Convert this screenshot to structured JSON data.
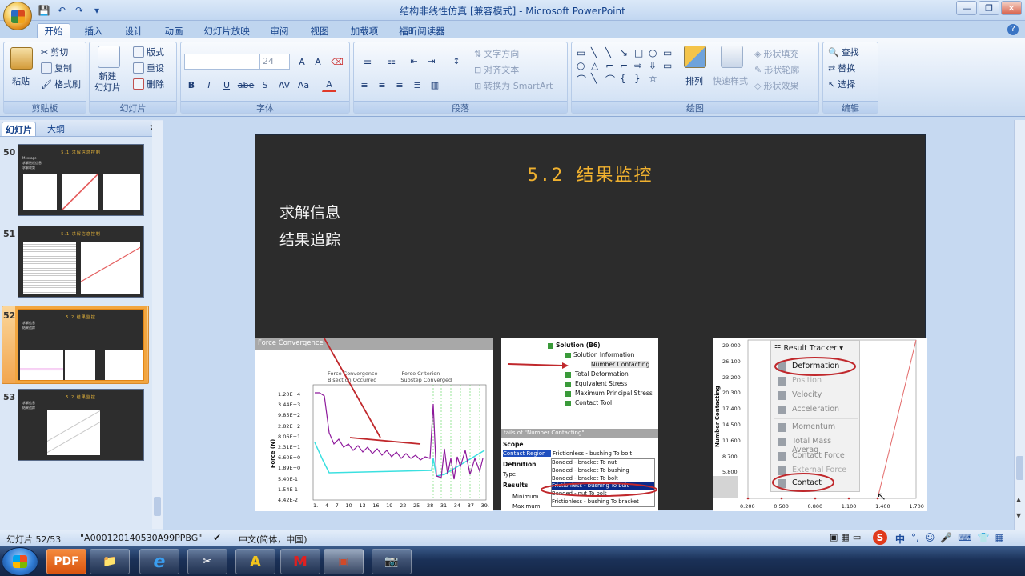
{
  "app": {
    "title": "结构非线性仿真 [兼容模式] - Microsoft PowerPoint"
  },
  "qat": {
    "save": "💾",
    "undo": "↶",
    "redo": "↷",
    "more": "▾"
  },
  "window": {
    "minimize": "—",
    "restore": "❐",
    "close": "✕"
  },
  "tabs": [
    "开始",
    "插入",
    "设计",
    "动画",
    "幻灯片放映",
    "审阅",
    "视图",
    "加载项",
    "福昕阅读器"
  ],
  "help": "?",
  "ribbon": {
    "clipboard": {
      "label": "剪贴板",
      "paste": "粘贴",
      "cut": "剪切",
      "copy": "复制",
      "format_painter": "格式刷"
    },
    "slides": {
      "label": "幻灯片",
      "new_slide": "新建\n幻灯片",
      "layout": "版式",
      "reset": "重设",
      "delete": "删除"
    },
    "font": {
      "label": "字体",
      "font_name": "",
      "font_size": "24",
      "bold": "B",
      "italic": "I",
      "underline": "U",
      "strike": "abe",
      "shadow": "S",
      "spacing": "AV",
      "case": "Aa",
      "color": "A",
      "grow": "A",
      "shrink": "A"
    },
    "paragraph": {
      "label": "段落",
      "text_direction": "文字方向",
      "align_text": "对齐文本",
      "smartart": "转换为 SmartArt"
    },
    "drawing": {
      "label": "绘图",
      "arrange": "排列",
      "quick_styles": "快速样式",
      "fill": "形状填充",
      "outline": "形状轮廓",
      "effects": "形状效果",
      "shapes": [
        "▭",
        "╲",
        "╲",
        "↘",
        "□",
        "○",
        "▭",
        "○",
        "△",
        "⌐",
        "⌐",
        "⇨",
        "⇩",
        "▭",
        "⌒",
        "╲",
        "⌒",
        "{",
        "}",
        "☆",
        ""
      ]
    },
    "editing": {
      "label": "编辑",
      "find": "查找",
      "replace": "替换",
      "select": "选择"
    }
  },
  "left_pane": {
    "tab_slides": "幻灯片",
    "tab_outline": "大纲",
    "close": "✕",
    "slides": [
      {
        "num": "50",
        "title": "5.1 求解信息控制",
        "lines": [
          "Message",
          "求解进程信息",
          "求解收敛"
        ]
      },
      {
        "num": "51",
        "title": "5.1 求解信息控制",
        "lines": []
      },
      {
        "num": "52",
        "title": "5.2 结果监控",
        "lines": [
          "求解信息",
          "结果追踪"
        ]
      },
      {
        "num": "53",
        "title": "5.2 结果监控",
        "lines": [
          "求解信息",
          "结果追踪"
        ]
      }
    ]
  },
  "slide": {
    "title": "5.2 结果监控",
    "bullets": [
      "求解信息",
      "结果追踪"
    ],
    "img1": {
      "title": "Force Convergence",
      "legend": [
        "Force Convergence",
        "Force Criterion",
        "Bisection Occurred",
        "Substep Converged"
      ],
      "yticks": [
        "1.20E+4",
        "3.44E+3",
        "9.85E+2",
        "2.82E+2",
        "8.06E+1",
        "2.31E+1",
        "6.60E+0",
        "1.89E+0",
        "5.40E-1",
        "1.54E-1",
        "4.42E-2"
      ],
      "xticks": [
        "1.",
        "4",
        "7",
        "10",
        "13",
        "16",
        "19",
        "22",
        "25",
        "28",
        "31",
        "34",
        "37",
        "39."
      ],
      "ylabel": "Force (N)"
    },
    "img2": {
      "tree": [
        "Solution (B6)",
        "Solution Information",
        "Number Contacting",
        "Total Deformation",
        "Equivalent Stress",
        "Maximum Principal Stress",
        "Contact Tool"
      ],
      "details_title": "tails of \"Number Contacting\"",
      "scope": "Scope",
      "contact_region": "Contact Region",
      "contact_value": "Frictionless - bushing To bolt",
      "definition": "Definition",
      "type": "Type",
      "results": "Results",
      "minimum": "Minimum",
      "maximum": "Maximum",
      "dropdown": [
        "Frictionless - bushing To bolt",
        "Bonded - bracket To nut",
        "Bonded - bracket To bushing",
        "Bonded - bracket To bolt",
        "Frictionless - bushing To bolt",
        "Bonded - nut To bolt",
        "Frictionless - bushing To bracket"
      ]
    },
    "img3": {
      "menu_title": "Result Tracker",
      "items": [
        "Deformation",
        "Position",
        "Velocity",
        "Acceleration",
        "Momentum",
        "Total Mass Averag",
        "Contact Force",
        "External Force",
        "Contact"
      ],
      "yticks": [
        "29.000",
        "26.100",
        "23.200",
        "20.300",
        "17.400",
        "14.500",
        "11.600",
        "8.700",
        "5.800"
      ],
      "xticks": [
        "0.200",
        "0.500",
        "0.800",
        "1.100",
        "1.400",
        "1.700"
      ],
      "ylabel": "Number Contacting"
    }
  },
  "status": {
    "slide": "幻灯片 52/53",
    "theme": "\"A000120140530A99PPBG\"",
    "lang": "中文(简体，中国)",
    "ime": "中"
  },
  "taskbar": {
    "items": [
      "PDF",
      "📁",
      "e",
      "✂",
      "A",
      "M",
      "▣",
      "📷"
    ]
  },
  "colors": {
    "accent": "#f0b12f",
    "ribbon": "#dce8f7",
    "slide_bg": "#2c2c2c",
    "annotation": "#c0282c"
  }
}
